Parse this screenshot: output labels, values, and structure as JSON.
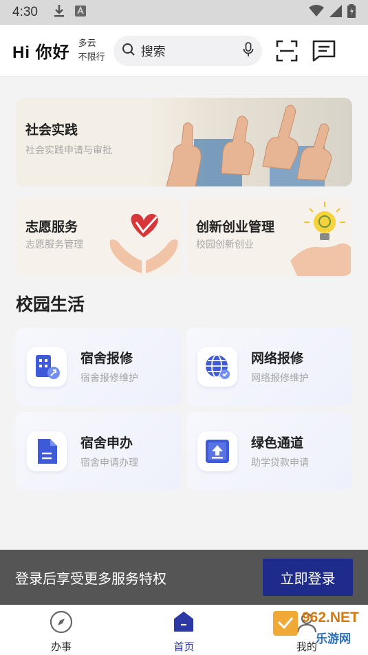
{
  "status_bar": {
    "time": "4:30"
  },
  "header": {
    "greeting": "Hi 你好",
    "weather_line1": "多云",
    "weather_line2": "不限行",
    "search_placeholder": "搜索"
  },
  "banners": {
    "big": {
      "title": "社会实践",
      "subtitle": "社会实践申请与审批"
    },
    "left": {
      "title": "志愿服务",
      "subtitle": "志愿服务管理"
    },
    "right": {
      "title": "创新创业管理",
      "subtitle": "校园创新创业"
    }
  },
  "section_title": "校园生活",
  "cards": [
    {
      "title": "宿舍报修",
      "subtitle": "宿舍报修维护",
      "icon": "building-repair-icon"
    },
    {
      "title": "网络报修",
      "subtitle": "网络报修维护",
      "icon": "globe-check-icon"
    },
    {
      "title": "宿舍申办",
      "subtitle": "宿舍申请办理",
      "icon": "document-icon"
    },
    {
      "title": "绿色通道",
      "subtitle": "助学贷款申请",
      "icon": "upload-box-icon"
    }
  ],
  "login_bar": {
    "text": "登录后享受更多服务特权",
    "button": "立即登录"
  },
  "bottom_nav": [
    {
      "label": "办事",
      "active": false
    },
    {
      "label": "首页",
      "active": true
    },
    {
      "label": "我的",
      "active": false
    }
  ],
  "watermark": {
    "brand": "962.NET",
    "sub": "乐游网"
  },
  "colors": {
    "accent": "#2c37a4",
    "login_button": "#1f2b8a",
    "login_bar": "#555556",
    "card_icon": "#3f5ad8"
  }
}
